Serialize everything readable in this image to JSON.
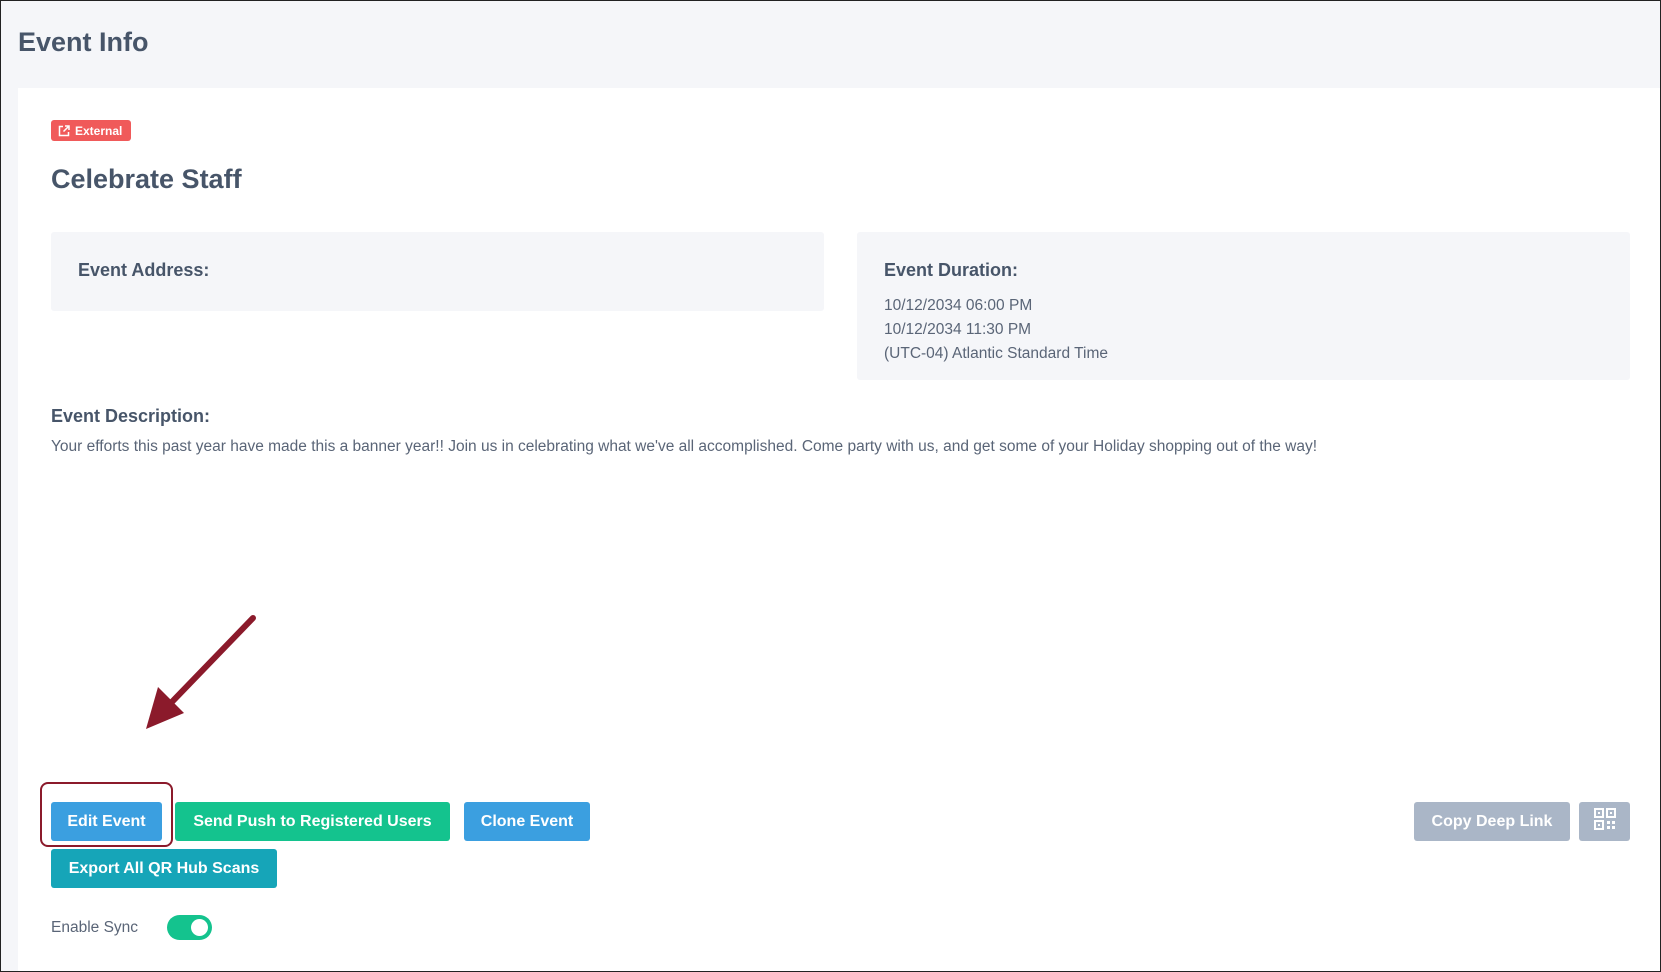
{
  "page": {
    "title": "Event Info"
  },
  "event": {
    "badge_label": "External",
    "name": "Celebrate Staff",
    "address_label": "Event Address:",
    "duration_label": "Event Duration:",
    "start": "10/12/2034 06:00 PM",
    "end": "10/12/2034 11:30 PM",
    "timezone": "(UTC-04) Atlantic Standard Time",
    "description_label": "Event Description:",
    "description": "Your efforts this past year have made this a banner year!! Join us in celebrating what we've all accomplished. Come party with us, and get some of your Holiday shopping out of the way!"
  },
  "actions": {
    "edit": "Edit Event",
    "push": "Send Push to Registered Users",
    "clone": "Clone Event",
    "export": "Export All QR Hub Scans",
    "copy_deep_link": "Copy Deep Link",
    "qr_icon": "qr-code-icon"
  },
  "sync": {
    "label": "Enable Sync",
    "enabled": true
  },
  "colors": {
    "blue_button": "#3b9fe0",
    "green_button": "#14c38e",
    "teal_button": "#16a5b8",
    "disabled_button": "#aab6c7",
    "external_badge": "#f05a5a",
    "annotation": "#8b1a2b"
  }
}
